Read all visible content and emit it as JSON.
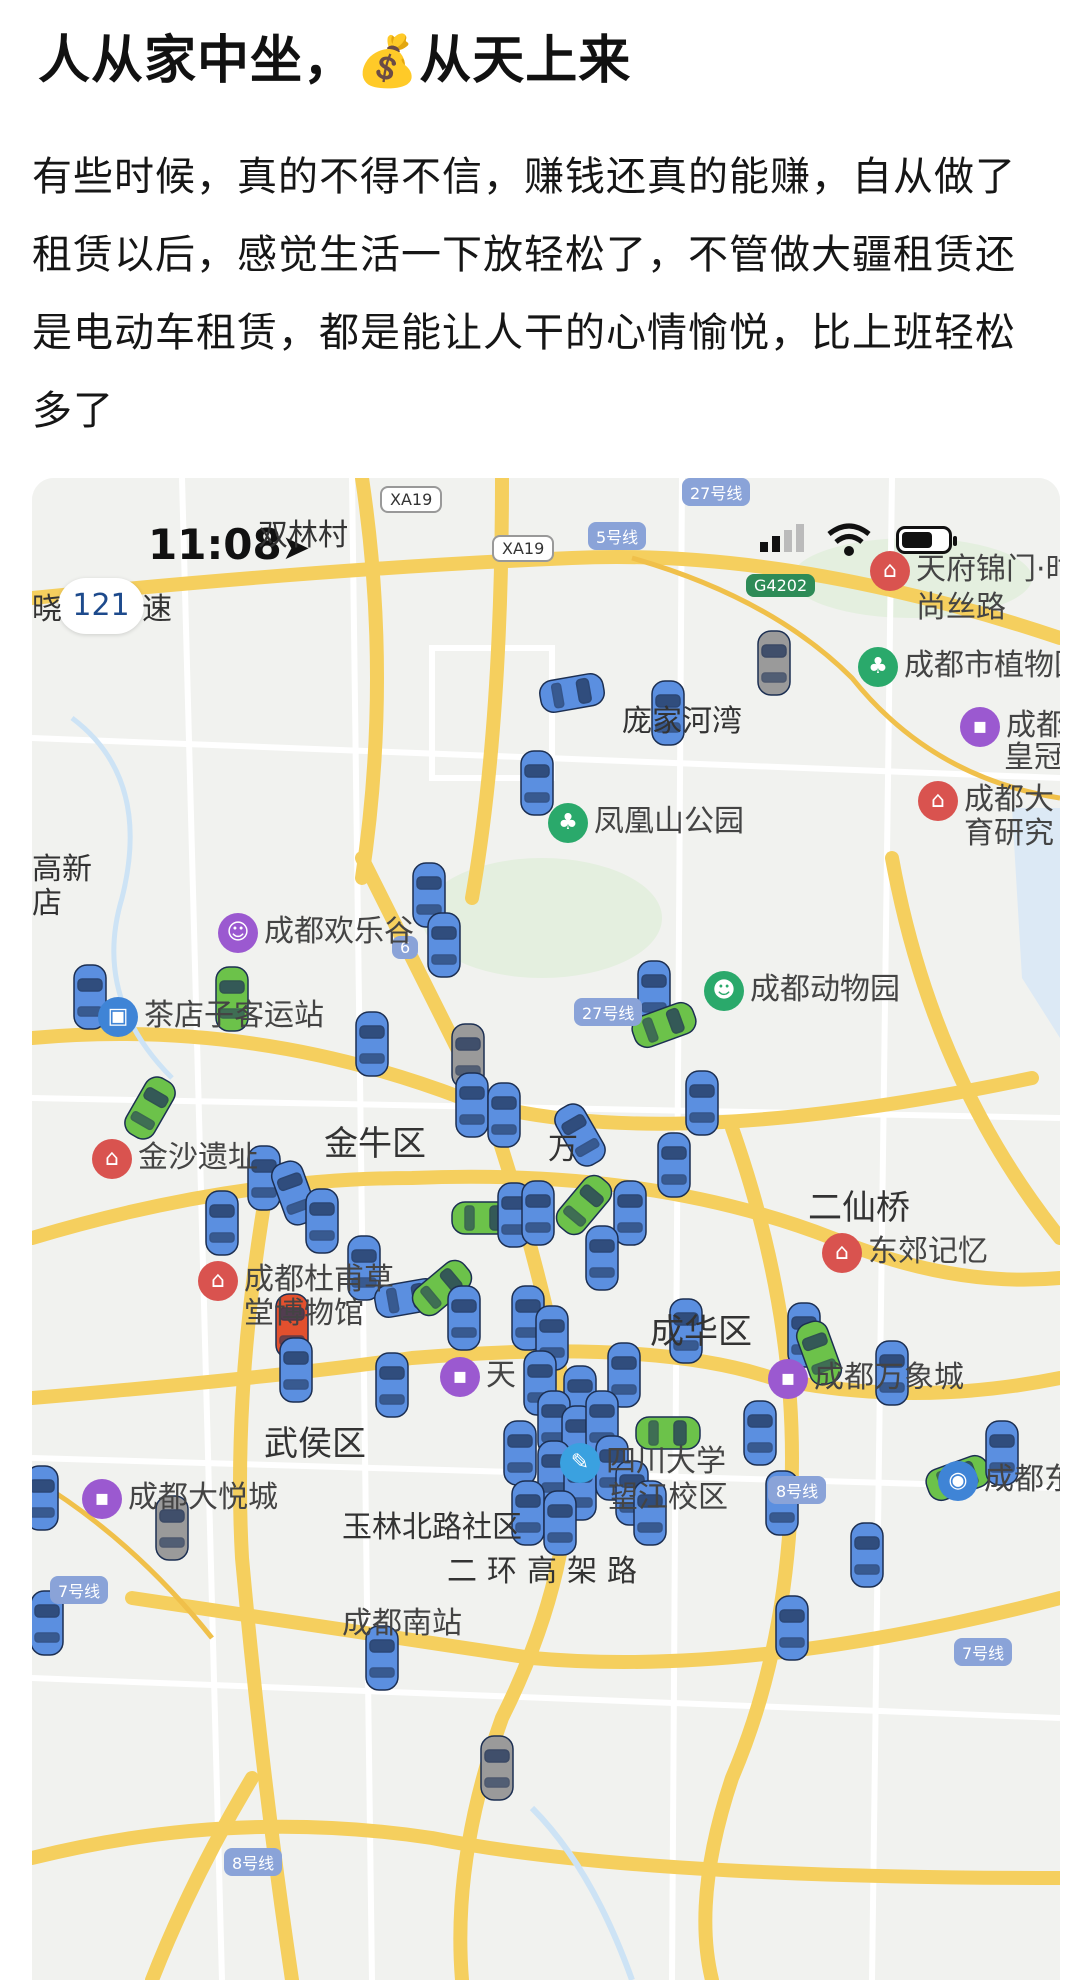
{
  "post": {
    "title": "人从家中坐，",
    "title_emoji": "💰",
    "title_end": "从天上来",
    "body": "有些时候，真的不得不信，赚钱还真的能赚，自从做了租赁以后，感觉生活一下放轻松了，不管做大疆租赁还是电动车租赁，都是能让人干的心情愉悦，比上班轻松多了"
  },
  "status_bar": {
    "time": "11:08"
  },
  "map": {
    "zoom_label": "121",
    "edge_char_left": "晓",
    "edge_char_speed": "速",
    "labels": {
      "shuanglin": "双林村",
      "pangjia": "庞家河湾",
      "jinniu": "金牛区",
      "erxianqiao": "二仙桥",
      "chenghua": "成华区",
      "wuhou": "武侯区",
      "yulin": "玉林北路社区",
      "erhuan": "二环高架路",
      "gaoxin_left": "高新",
      "gaoxin_left2": "店",
      "tianfu_top": "天府锦门·时",
      "tianfu_top2": "尚丝路",
      "dafu": "万",
      "tian": "天"
    },
    "pois": {
      "zhiwuyuan": "成都市植物园",
      "huangguan": "成都",
      "huangguan2": "皇冠",
      "tiyu": "成都大",
      "tiyu2": "育研究",
      "fenghuang": "凤凰山公园",
      "huanle": "成都欢乐谷",
      "chadian": "茶店子客运站",
      "dongwuyuan": "成都动物园",
      "jinsha": "金沙遗址",
      "dufu": "成都杜甫草",
      "dufu2": "堂博物馆",
      "dongjiao": "东郊记忆",
      "wanxiang": "成都万象城",
      "sichuan": "四川大学",
      "sichuan2": "望江校区",
      "dayue": "成都大悦城",
      "nanzhan": "成都南站",
      "chengdong": "成都东"
    },
    "road_badges": {
      "xa19a": "XA19",
      "xa19b": "XA19",
      "g4202": "G4202",
      "line5": "5号线",
      "line27a": "27号线",
      "line27b": "27号线",
      "line8a": "8号线",
      "line8b": "8号线",
      "line7a": "7号线",
      "line7b": "7号线",
      "line6": "6"
    },
    "colors": {
      "car_blue": "#5b8fe0",
      "car_green": "#6cc24a",
      "car_gray": "#9a9a9a",
      "car_red": "#e2502e",
      "road": "#f7d46a"
    }
  }
}
